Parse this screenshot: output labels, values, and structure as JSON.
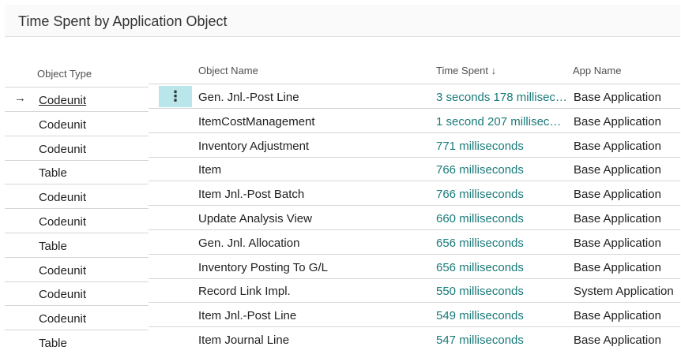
{
  "page": {
    "title": "Time Spent by Application Object"
  },
  "left": {
    "header": "Object Type",
    "arrow_icon": "→",
    "rows": [
      "Codeunit",
      "Codeunit",
      "Codeunit",
      "Table",
      "Codeunit",
      "Codeunit",
      "Table",
      "Codeunit",
      "Codeunit",
      "Codeunit",
      "Table"
    ]
  },
  "table": {
    "columns": {
      "object_name": "Object Name",
      "time_spent": "Time Spent ↓",
      "app_name": "App Name"
    },
    "kebab_icon": "⋮",
    "rows": [
      {
        "name": "Gen. Jnl.-Post Line",
        "time": "3 seconds 178 millisec…",
        "app": "Base Application"
      },
      {
        "name": "ItemCostManagement",
        "time": "1 second 207 milliseco…",
        "app": "Base Application"
      },
      {
        "name": "Inventory Adjustment",
        "time": "771 milliseconds",
        "app": "Base Application"
      },
      {
        "name": "Item",
        "time": "766 milliseconds",
        "app": "Base Application"
      },
      {
        "name": "Item Jnl.-Post Batch",
        "time": "766 milliseconds",
        "app": "Base Application"
      },
      {
        "name": "Update Analysis View",
        "time": "660 milliseconds",
        "app": "Base Application"
      },
      {
        "name": "Gen. Jnl. Allocation",
        "time": "656 milliseconds",
        "app": "Base Application"
      },
      {
        "name": "Inventory Posting To G/L",
        "time": "656 milliseconds",
        "app": "Base Application"
      },
      {
        "name": "Record Link Impl.",
        "time": "550 milliseconds",
        "app": "System Application"
      },
      {
        "name": "Item Jnl.-Post Line",
        "time": "549 milliseconds",
        "app": "Base Application"
      },
      {
        "name": "Item Journal Line",
        "time": "547 milliseconds",
        "app": "Base Application"
      }
    ]
  },
  "colors": {
    "accent_text": "#1a7a7a",
    "selected_cell": "#b9e6ea"
  }
}
